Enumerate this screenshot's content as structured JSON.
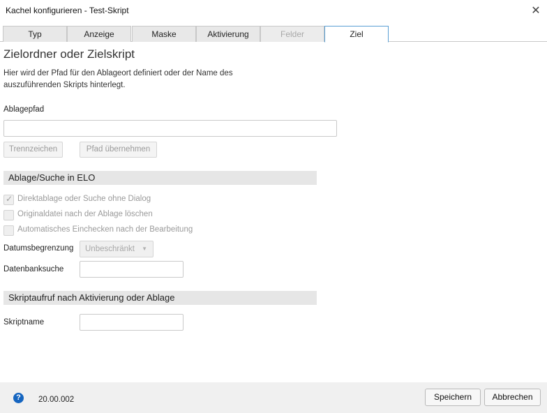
{
  "window": {
    "title": "Kachel konfigurieren - Test-Skript",
    "close_glyph": "✕"
  },
  "tabs": [
    {
      "label": "Typ"
    },
    {
      "label": "Anzeige"
    },
    {
      "label": "Maske"
    },
    {
      "label": "Aktivierung"
    },
    {
      "label": "Felder"
    },
    {
      "label": "Ziel"
    }
  ],
  "main": {
    "heading": "Zielordner oder Zielskript",
    "description": "Hier wird der Pfad für den Ablageort definiert oder der Name des auszuführenden Skripts hinterlegt.",
    "ablagepfad_label": "Ablagepfad",
    "ablagepfad_value": "",
    "trennzeichen_label": "Trennzeichen",
    "pfad_uebernehmen_label": "Pfad übernehmen"
  },
  "ablage_section": {
    "title": "Ablage/Suche in ELO",
    "options": [
      {
        "label": "Direktablage oder Suche ohne Dialog",
        "checked": true
      },
      {
        "label": "Originaldatei nach der Ablage löschen",
        "checked": false
      },
      {
        "label": "Automatisches Einchecken nach der Bearbeitung",
        "checked": false
      }
    ],
    "datumsbegrenzung_label": "Datumsbegrenzung",
    "datumsbegrenzung_value": "Unbeschränkt",
    "datenbanksuche_label": "Datenbanksuche",
    "datenbanksuche_value": ""
  },
  "skript_section": {
    "title": "Skriptaufruf nach Aktivierung oder Ablage",
    "skriptname_label": "Skriptname",
    "skriptname_value": ""
  },
  "footer": {
    "help_glyph": "?",
    "version": "20.00.002",
    "save_label": "Speichern",
    "cancel_label": "Abbrechen"
  },
  "colors": {
    "accent": "#5a9fd4",
    "help_icon": "#1565c0",
    "section_bg": "#e6e6e6"
  }
}
